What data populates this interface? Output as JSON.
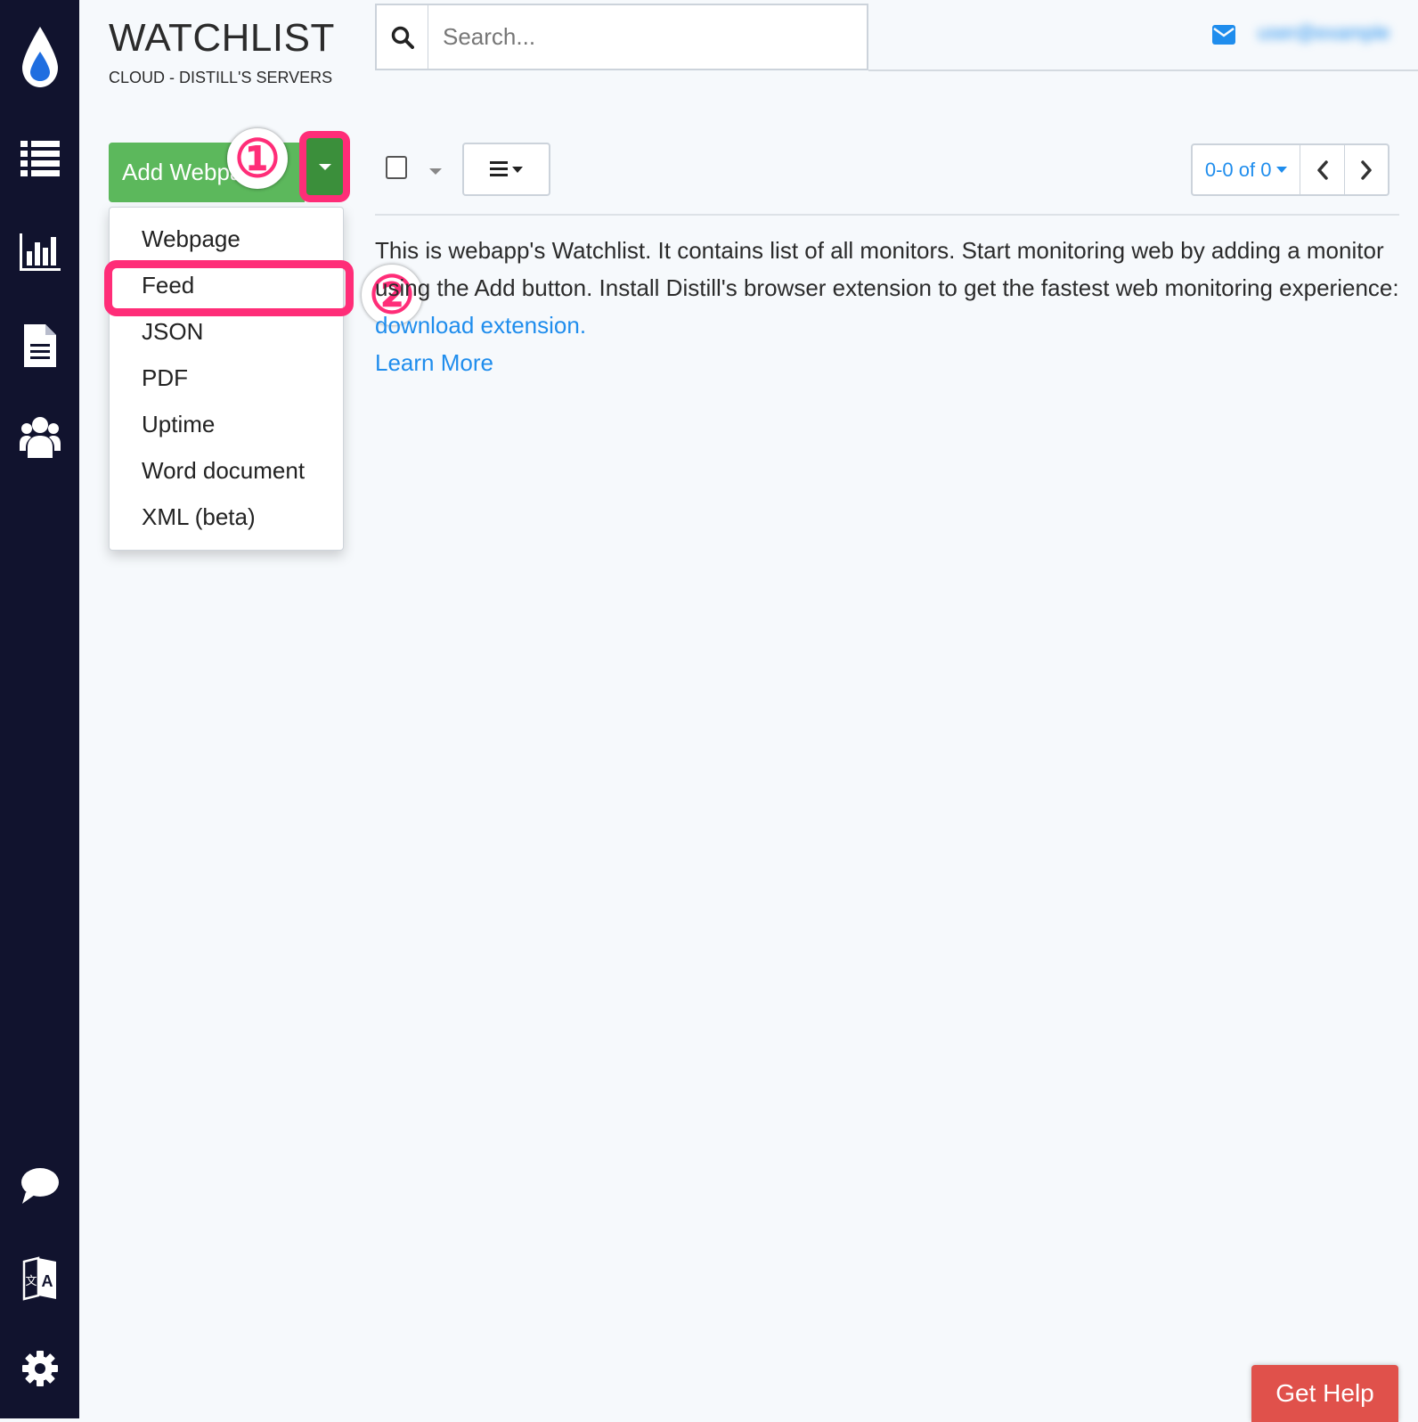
{
  "header": {
    "title": "WATCHLIST",
    "subtitle": "CLOUD - DISTILL'S SERVERS",
    "user_name": "user@example"
  },
  "search": {
    "placeholder": "Search..."
  },
  "toolbar": {
    "add_label": "Add Webpage",
    "pager_range": "0-0 of 0"
  },
  "annotations": {
    "step1": "①",
    "step2": "②"
  },
  "dropdown": {
    "items": [
      "Webpage",
      "Feed",
      "JSON",
      "PDF",
      "Uptime",
      "Word document",
      "XML (beta)"
    ]
  },
  "intro": {
    "text_before": "This is webapp's Watchlist. It contains list of all monitors. Start monitoring web by adding a monitor using the Add button. Install Distill's browser extension to get the fastest web monitoring experience: ",
    "link_download": "download extension.",
    "link_learn": "Learn More"
  },
  "help": {
    "label": "Get Help"
  },
  "sidebar": {
    "items": [
      "drop-logo-icon",
      "list-icon",
      "chart-icon",
      "document-icon",
      "users-icon",
      "chat-icon",
      "translate-icon",
      "gear-icon"
    ]
  },
  "colors": {
    "sidebar": "#11132e",
    "primary_green": "#5cb85c",
    "annotation_pink": "#ff2d78",
    "link_blue": "#1f8ded",
    "help_red": "#e0514b"
  }
}
